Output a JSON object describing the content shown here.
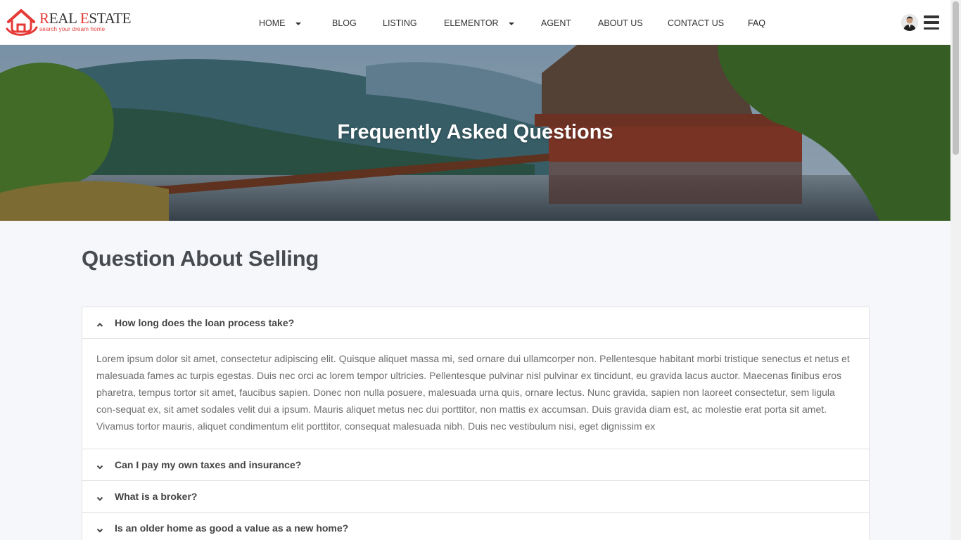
{
  "brand": {
    "title_first": "R",
    "title_rest": "EAL ",
    "title_second": "E",
    "title_last": "STATE",
    "tagline": "search your dream home"
  },
  "nav": [
    {
      "label": "HOME",
      "dropdown": true
    },
    {
      "label": "BLOG",
      "dropdown": false
    },
    {
      "label": "LISTING",
      "dropdown": false
    },
    {
      "label": "ELEMENTOR",
      "dropdown": true
    },
    {
      "label": "AGENT",
      "dropdown": false
    },
    {
      "label": "ABOUT US",
      "dropdown": false
    },
    {
      "label": "CONTACT US",
      "dropdown": false
    },
    {
      "label": "FAQ",
      "dropdown": false
    }
  ],
  "hero": {
    "title": "Frequently Asked Questions"
  },
  "section": {
    "title": "Question About Selling"
  },
  "faq": [
    {
      "question": "How long does the loan process take?",
      "expanded": true,
      "answer": "Lorem ipsum dolor sit amet, consectetur adipiscing elit. Quisque aliquet massa mi, sed ornare dui ullamcorper non. Pellentesque habitant morbi tristique senectus et netus et malesuada fames ac turpis egestas. Duis nec orci ac lorem tempor ultricies. Pellentesque pulvinar nisl pulvinar ex tincidunt, eu gravida lacus auctor. Maecenas finibus eros pharetra, tempus tortor sit amet, faucibus sapien. Donec non nulla posuere, malesuada urna quis, ornare lectus. Nunc gravida, sapien non laoreet consectetur, sem ligula con-sequat ex, sit amet sodales velit dui a ipsum. Mauris aliquet metus nec dui porttitor, non mattis ex accumsan. Duis gravida diam est, ac molestie erat porta sit amet. Vivamus tortor mauris, aliquet condimentum elit porttitor, consequat malesuada nibh. Duis nec vestibulum nisi, eget dignissim ex"
    },
    {
      "question": "Can I pay my own taxes and insurance?",
      "expanded": false
    },
    {
      "question": "What is a broker?",
      "expanded": false
    },
    {
      "question": "Is an older home as good a value as a new home?",
      "expanded": false
    }
  ],
  "colors": {
    "brand_red": "#e53935",
    "text_dark": "#474b50"
  },
  "icons": {
    "profile": "avatar-icon",
    "menu": "hamburger-menu-icon",
    "expanded": "chevron-up-icon",
    "collapsed": "chevron-down-icon"
  }
}
